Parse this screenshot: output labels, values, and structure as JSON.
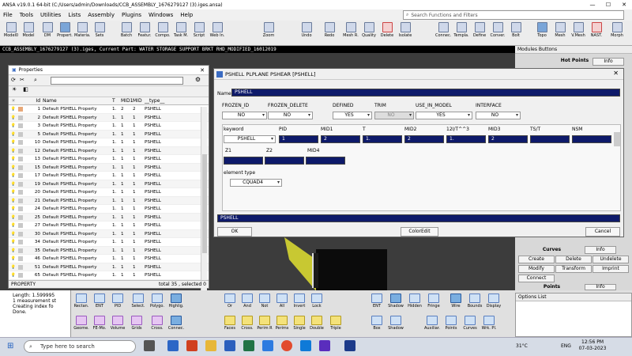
{
  "window": {
    "title": "ANSA v19.0.1 64-bit (C:/Users/admin/Downloads/CCB_ASSEMBLY_1676279127 (3).iges.ansa)",
    "min": "—",
    "max": "☐",
    "close": "✕"
  },
  "menu": [
    "File",
    "Tools",
    "Utilities",
    "Lists",
    "Assembly",
    "Plugins",
    "Windows",
    "Help"
  ],
  "search": {
    "placeholder": "Search Functions and Filters"
  },
  "toolbar": [
    "Model0",
    "Model",
    "DM",
    "Propert.",
    "Materia.",
    "Sets",
    "Batch",
    "Featur.",
    "Compo.",
    "Task M.",
    "Script",
    "Web In.",
    "Zoom",
    "Undo",
    "Redo",
    "Mesh R.",
    "Quality",
    "Delete",
    "Isolate",
    "Connec.",
    "Templa.",
    "Define",
    "Conver.",
    "Bolt",
    "Topo",
    "Mesh",
    "V.Mesh",
    "NAST.",
    "Morph"
  ],
  "status_line": "CCB_ASSEMBLY_1676279127 (3).iges,  Current Part: WATER STORAGE SUPPORT BRKT RHD_MODIFIED_16012019",
  "right_panel": {
    "header": "Modules Buttons",
    "hot_points": "Hot Points",
    "info": "Info",
    "curves": "Curves",
    "buttons": [
      "Create",
      "Delete",
      "Undelete",
      "Modify",
      "Transform",
      "Imprint"
    ],
    "connect": "Connect",
    "points": "Points"
  },
  "properties": {
    "title": "Properties",
    "columns": [
      "Id",
      "Name",
      "T",
      "MID1",
      "MID",
      "__type__"
    ],
    "rows": [
      {
        "id": "1",
        "name": "Default PSHELL Property",
        "t": "1.",
        "mid1": "2",
        "mid": "2",
        "type": "PSHELL"
      },
      {
        "id": "2",
        "name": "Default PSHELL Property",
        "t": "1.",
        "mid1": "1",
        "mid": "1",
        "type": "PSHELL"
      },
      {
        "id": "3",
        "name": "Default PSHELL Property",
        "t": "1.",
        "mid1": "1",
        "mid": "1",
        "type": "PSHELL"
      },
      {
        "id": "5",
        "name": "Default PSHELL Property",
        "t": "1.",
        "mid1": "1",
        "mid": "1",
        "type": "PSHELL"
      },
      {
        "id": "10",
        "name": "Default PSHELL Property",
        "t": "1.",
        "mid1": "1",
        "mid": "1",
        "type": "PSHELL"
      },
      {
        "id": "12",
        "name": "Default PSHELL Property",
        "t": "1.",
        "mid1": "1",
        "mid": "1",
        "type": "PSHELL"
      },
      {
        "id": "13",
        "name": "Default PSHELL Property",
        "t": "1.",
        "mid1": "1",
        "mid": "1",
        "type": "PSHELL"
      },
      {
        "id": "15",
        "name": "Default PSHELL Property",
        "t": "1.",
        "mid1": "1",
        "mid": "1",
        "type": "PSHELL"
      },
      {
        "id": "17",
        "name": "Default PSHELL Property",
        "t": "1.",
        "mid1": "1",
        "mid": "1",
        "type": "PSHELL"
      },
      {
        "id": "19",
        "name": "Default PSHELL Property",
        "t": "1.",
        "mid1": "1",
        "mid": "1",
        "type": "PSHELL"
      },
      {
        "id": "20",
        "name": "Default PSHELL Property",
        "t": "1.",
        "mid1": "1",
        "mid": "1",
        "type": "PSHELL"
      },
      {
        "id": "21",
        "name": "Default PSHELL Property",
        "t": "1.",
        "mid1": "1",
        "mid": "1",
        "type": "PSHELL"
      },
      {
        "id": "24",
        "name": "Default PSHELL Property",
        "t": "1.",
        "mid1": "1",
        "mid": "1",
        "type": "PSHELL"
      },
      {
        "id": "25",
        "name": "Default PSHELL Property",
        "t": "1.",
        "mid1": "1",
        "mid": "1",
        "type": "PSHELL"
      },
      {
        "id": "27",
        "name": "Default PSHELL Property",
        "t": "1.",
        "mid1": "1",
        "mid": "1",
        "type": "PSHELL"
      },
      {
        "id": "30",
        "name": "Default PSHELL Property",
        "t": "1.",
        "mid1": "1",
        "mid": "1",
        "type": "PSHELL"
      },
      {
        "id": "34",
        "name": "Default PSHELL Property",
        "t": "1.",
        "mid1": "1",
        "mid": "1",
        "type": "PSHELL"
      },
      {
        "id": "35",
        "name": "Default PSHELL Property",
        "t": "1.",
        "mid1": "1",
        "mid": "1",
        "type": "PSHELL"
      },
      {
        "id": "46",
        "name": "Default PSHELL Property",
        "t": "1.",
        "mid1": "1",
        "mid": "1",
        "type": "PSHELL"
      },
      {
        "id": "51",
        "name": "Default PSHELL Property",
        "t": "1.",
        "mid1": "1",
        "mid": "1",
        "type": "PSHELL"
      },
      {
        "id": "65",
        "name": "Default PSHELL Property",
        "t": "1.",
        "mid1": "1",
        "mid": "1",
        "type": "PSHELL"
      }
    ],
    "status_left": "PROPERTY",
    "status_right": "total 35 , selected 0"
  },
  "dialog": {
    "title": "PSHELL PLPLANE PSHEAR [PSHELL]",
    "name_label": "Name",
    "name_value": "PSHELL",
    "flags": [
      {
        "label": "FROZEN_ID",
        "value": "NO"
      },
      {
        "label": "FROZEN_DELETE",
        "value": "NO"
      },
      {
        "label": "DEFINED",
        "value": "YES"
      },
      {
        "label": "TRIM",
        "value": "NO"
      },
      {
        "label": "USE_IN_MODEL",
        "value": "YES"
      },
      {
        "label": "INTERFACE",
        "value": "NO"
      }
    ],
    "grid_headers": [
      "keyword",
      "PID",
      "MID1",
      "T",
      "MID2",
      "12I/T^^3",
      "MID3",
      "TS/T",
      "NSM"
    ],
    "grid_values": [
      "PSHELL",
      "1",
      "2",
      "1.",
      "2",
      "1.",
      "2",
      "",
      ""
    ],
    "row2_headers": [
      "Z1",
      "Z2",
      "MID4"
    ],
    "element_type_label": "element type",
    "element_type_value": "CQUAD4",
    "comment": "PSHELL",
    "ok": "OK",
    "colorEdit": "ColorEdit",
    "cancel": "Cancel"
  },
  "log": [
    "Length: 1.599995",
    "1 measurement st",
    "Creating index fo",
    "Done."
  ],
  "bottom_tools": [
    "Rectan.",
    "ENT",
    "PID",
    "Select.",
    "Polygo.",
    "Highlig.",
    "Geome.",
    "FE-Mo.",
    "Volume",
    "Grids",
    "Cross.",
    "Connec.",
    "Or",
    "And",
    "Not",
    "All",
    "Invert",
    "Lock",
    "Faces",
    "Cross.",
    "Perim R",
    "Perims",
    "Single",
    "Double",
    "Triple",
    "ENT",
    "Shadow",
    "Hidden",
    "Fringe",
    "Wire",
    "Bounds",
    "Display",
    "Box",
    "Shadow",
    "Auxiliar.",
    "Points",
    "Curves",
    "Wrk. Pl."
  ],
  "options_list": "Options List",
  "taskbar": {
    "search": "Type here to search",
    "temp": "31°C",
    "lang": "ENG",
    "time": "12:56 PM",
    "date": "07-03-2023"
  }
}
